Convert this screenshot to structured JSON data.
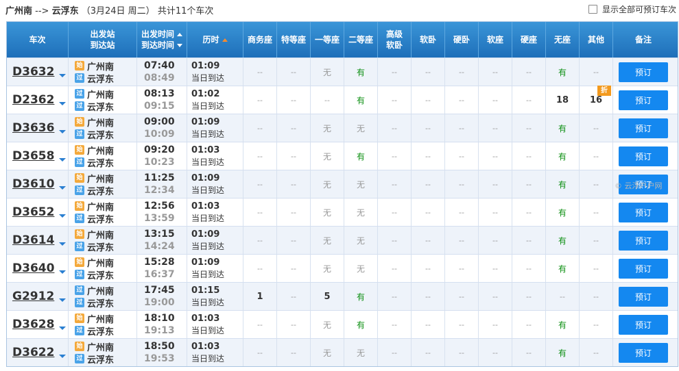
{
  "route": {
    "from": "广州南",
    "arrow": "-->",
    "to": "云浮东",
    "date": "（3月24日  周二）",
    "summary": "共计11个车次"
  },
  "show_all": {
    "label": "显示全部可预订车次",
    "checked": false
  },
  "headers": {
    "train": "车次",
    "stations_top": "出发站",
    "stations_bottom": "到达站",
    "times_top": "出发时间",
    "times_bottom": "到达时间",
    "duration": "历时",
    "seats": [
      "商务座",
      "特等座",
      "一等座",
      "二等座",
      "高级软卧",
      "软卧",
      "硬卧",
      "软座",
      "硬座",
      "无座",
      "其他"
    ],
    "seat_top": "高级",
    "seat_bottom": "软卧",
    "note": "备注"
  },
  "badges": {
    "start": "始",
    "pass": "过"
  },
  "book_label": "预订",
  "discount_label": "折",
  "watermark": "© 云浮户户网",
  "rows": [
    {
      "train": "D3632",
      "from": "广州南",
      "to": "云浮东",
      "dep": "07:40",
      "arr": "08:49",
      "dur": "01:09",
      "day": "当日到达",
      "start_badge": "start",
      "seats": [
        "--",
        "--",
        "无",
        "有",
        "--",
        "--",
        "--",
        "--",
        "--",
        "有",
        "--"
      ]
    },
    {
      "train": "D2362",
      "from": "广州南",
      "to": "云浮东",
      "dep": "08:13",
      "arr": "09:15",
      "dur": "01:02",
      "day": "当日到达",
      "start_badge": "pass",
      "seats": [
        "--",
        "--",
        "--",
        "有",
        "--",
        "--",
        "--",
        "--",
        "--",
        "18",
        "16"
      ],
      "discount": true
    },
    {
      "train": "D3636",
      "from": "广州南",
      "to": "云浮东",
      "dep": "09:00",
      "arr": "10:09",
      "dur": "01:09",
      "day": "当日到达",
      "start_badge": "start",
      "seats": [
        "--",
        "--",
        "无",
        "无",
        "--",
        "--",
        "--",
        "--",
        "--",
        "有",
        "--"
      ]
    },
    {
      "train": "D3658",
      "from": "广州南",
      "to": "云浮东",
      "dep": "09:20",
      "arr": "10:23",
      "dur": "01:03",
      "day": "当日到达",
      "start_badge": "start",
      "seats": [
        "--",
        "--",
        "无",
        "有",
        "--",
        "--",
        "--",
        "--",
        "--",
        "有",
        "--"
      ]
    },
    {
      "train": "D3610",
      "from": "广州南",
      "to": "云浮东",
      "dep": "11:25",
      "arr": "12:34",
      "dur": "01:09",
      "day": "当日到达",
      "start_badge": "start",
      "seats": [
        "--",
        "--",
        "无",
        "无",
        "--",
        "--",
        "--",
        "--",
        "--",
        "有",
        "--"
      ]
    },
    {
      "train": "D3652",
      "from": "广州南",
      "to": "云浮东",
      "dep": "12:56",
      "arr": "13:59",
      "dur": "01:03",
      "day": "当日到达",
      "start_badge": "start",
      "seats": [
        "--",
        "--",
        "无",
        "无",
        "--",
        "--",
        "--",
        "--",
        "--",
        "有",
        "--"
      ]
    },
    {
      "train": "D3614",
      "from": "广州南",
      "to": "云浮东",
      "dep": "13:15",
      "arr": "14:24",
      "dur": "01:09",
      "day": "当日到达",
      "start_badge": "start",
      "seats": [
        "--",
        "--",
        "无",
        "无",
        "--",
        "--",
        "--",
        "--",
        "--",
        "有",
        "--"
      ]
    },
    {
      "train": "D3640",
      "from": "广州南",
      "to": "云浮东",
      "dep": "15:28",
      "arr": "16:37",
      "dur": "01:09",
      "day": "当日到达",
      "start_badge": "start",
      "seats": [
        "--",
        "--",
        "无",
        "无",
        "--",
        "--",
        "--",
        "--",
        "--",
        "有",
        "--"
      ]
    },
    {
      "train": "G2912",
      "from": "广州南",
      "to": "云浮东",
      "dep": "17:45",
      "arr": "19:00",
      "dur": "01:15",
      "day": "当日到达",
      "start_badge": "pass",
      "seats": [
        "1",
        "--",
        "5",
        "有",
        "--",
        "--",
        "--",
        "--",
        "--",
        "--",
        "--"
      ]
    },
    {
      "train": "D3628",
      "from": "广州南",
      "to": "云浮东",
      "dep": "18:10",
      "arr": "19:13",
      "dur": "01:03",
      "day": "当日到达",
      "start_badge": "start",
      "seats": [
        "--",
        "--",
        "无",
        "有",
        "--",
        "--",
        "--",
        "--",
        "--",
        "有",
        "--"
      ]
    },
    {
      "train": "D3622",
      "from": "广州南",
      "to": "云浮东",
      "dep": "18:50",
      "arr": "19:53",
      "dur": "01:03",
      "day": "当日到达",
      "start_badge": "start",
      "seats": [
        "--",
        "--",
        "无",
        "无",
        "--",
        "--",
        "--",
        "--",
        "--",
        "有",
        "--"
      ]
    }
  ]
}
